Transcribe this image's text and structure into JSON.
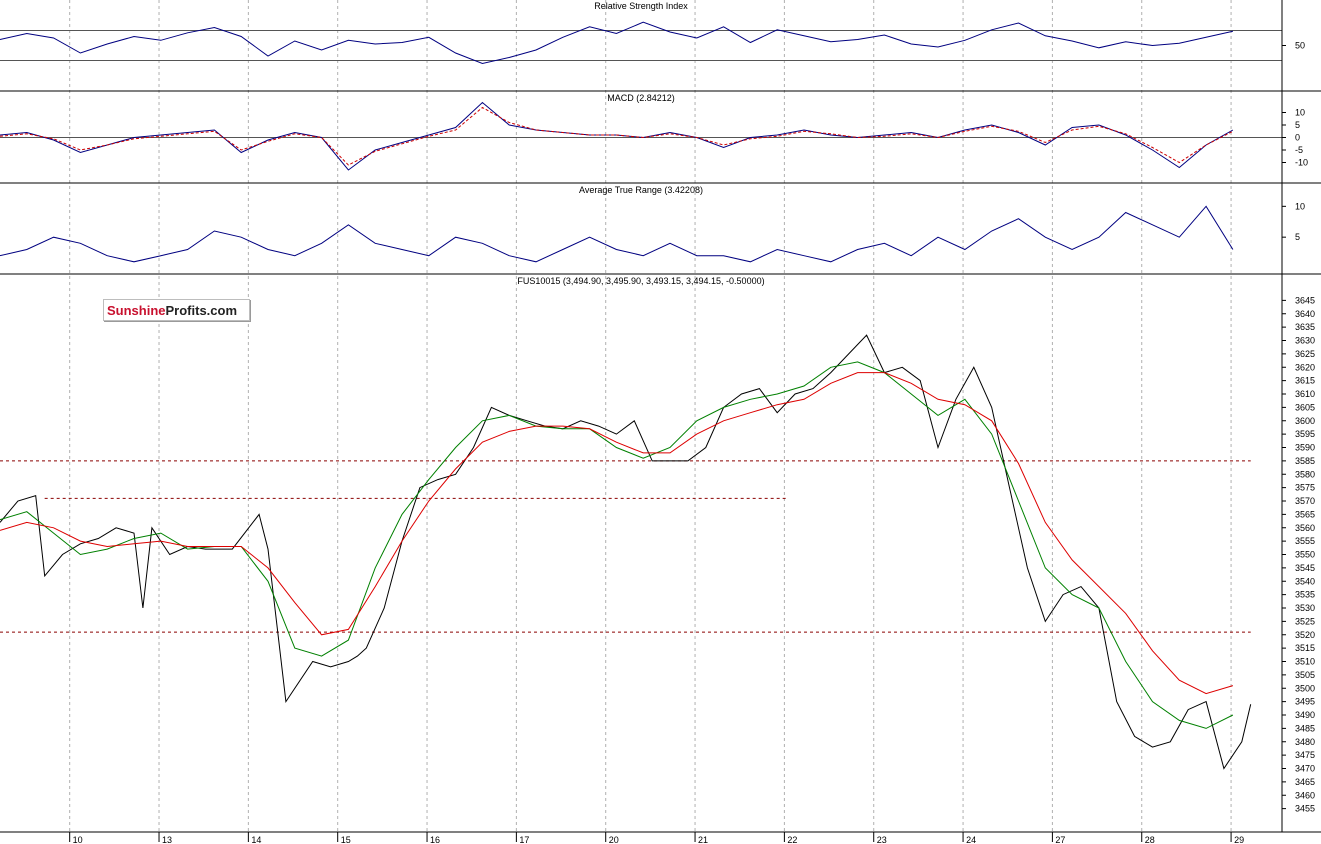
{
  "chart_data": {
    "type": "line",
    "symbol_label": "FUS10015 (3,494.90, 3,495.90, 3,493.15, 3,494.15, -0.50000)",
    "x_ticks": [
      "10",
      "13",
      "14",
      "15",
      "16",
      "17",
      "20",
      "21",
      "22",
      "23",
      "24",
      "27",
      "28",
      "29"
    ],
    "panels": [
      {
        "id": "rsi",
        "title": "Relative Strength Index",
        "type": "line",
        "y_ticks": [
          50
        ],
        "ylim": [
          0,
          100
        ],
        "reference_lines": [
          30,
          70
        ],
        "series": [
          {
            "color": "#000080",
            "x": [
              0,
              0.3,
              0.6,
              0.9,
              1.2,
              1.5,
              1.8,
              2.1,
              2.4,
              2.7,
              3.0,
              3.3,
              3.6,
              3.9,
              4.2,
              4.5,
              4.8,
              5.1,
              5.4,
              5.7,
              6.0,
              6.3,
              6.6,
              6.9,
              7.2,
              7.5,
              7.8,
              8.1,
              8.4,
              8.7,
              9.0,
              9.3,
              9.6,
              9.9,
              10.2,
              10.5,
              10.8,
              11.1,
              11.4,
              11.7,
              12.0,
              12.3,
              12.6,
              12.9,
              13.2,
              13.5,
              13.8
            ],
            "values": [
              58,
              66,
              60,
              40,
              52,
              62,
              57,
              67,
              74,
              62,
              36,
              56,
              44,
              57,
              52,
              54,
              61,
              40,
              26,
              34,
              44,
              61,
              75,
              66,
              81,
              68,
              60,
              75,
              54,
              71,
              63,
              55,
              58,
              64,
              52,
              48,
              57,
              71,
              80,
              63,
              56,
              47,
              55,
              50,
              53,
              61,
              69
            ]
          }
        ]
      },
      {
        "id": "macd",
        "title": "MACD (2.84212)",
        "type": "line",
        "y_ticks": [
          10,
          5,
          0,
          -5,
          -10
        ],
        "ylim": [
          -15,
          15
        ],
        "series": [
          {
            "color": "#000080",
            "x": [
              0,
              0.3,
              0.6,
              0.9,
              1.2,
              1.5,
              1.8,
              2.1,
              2.4,
              2.7,
              3.0,
              3.3,
              3.6,
              3.9,
              4.2,
              4.5,
              4.8,
              5.1,
              5.4,
              5.7,
              6.0,
              6.3,
              6.6,
              6.9,
              7.2,
              7.5,
              7.8,
              8.1,
              8.4,
              8.7,
              9.0,
              9.3,
              9.6,
              9.9,
              10.2,
              10.5,
              10.8,
              11.1,
              11.4,
              11.7,
              12.0,
              12.3,
              12.6,
              12.9,
              13.2,
              13.5,
              13.8
            ],
            "values": [
              1,
              2,
              -1,
              -6,
              -3,
              0,
              1,
              2,
              3,
              -6,
              -1,
              2,
              0,
              -13,
              -5,
              -2,
              1,
              4,
              14,
              5,
              3,
              2,
              1,
              1,
              0,
              2,
              0,
              -4,
              0,
              1,
              3,
              1,
              0,
              1,
              2,
              0,
              3,
              5,
              2,
              -3,
              4,
              5,
              1,
              -5,
              -12,
              -3,
              3
            ]
          },
          {
            "color": "#cc0000",
            "dashed": true,
            "x": [
              0,
              0.3,
              0.6,
              0.9,
              1.2,
              1.5,
              1.8,
              2.1,
              2.4,
              2.7,
              3.0,
              3.3,
              3.6,
              3.9,
              4.2,
              4.5,
              4.8,
              5.1,
              5.4,
              5.7,
              6.0,
              6.3,
              6.6,
              6.9,
              7.2,
              7.5,
              7.8,
              8.1,
              8.4,
              8.7,
              9.0,
              9.3,
              9.6,
              9.9,
              10.2,
              10.5,
              10.8,
              11.1,
              11.4,
              11.7,
              12.0,
              12.3,
              12.6,
              12.9,
              13.2,
              13.5,
              13.8
            ],
            "values": [
              0.5,
              1.5,
              -0.5,
              -5,
              -3,
              -0.5,
              0.5,
              1.5,
              2.5,
              -5,
              -1.5,
              1.5,
              0,
              -11,
              -5.5,
              -2.5,
              0.5,
              3,
              12,
              6,
              3,
              2,
              1,
              1,
              0,
              1.5,
              0,
              -3,
              -0.5,
              0.5,
              2.5,
              1.5,
              0,
              0.5,
              1.5,
              0,
              2.5,
              4.5,
              2.5,
              -2,
              3,
              4.5,
              1.5,
              -4,
              -10,
              -3,
              2.5
            ]
          }
        ]
      },
      {
        "id": "atr",
        "title": "Average True Range (3.42208)",
        "type": "line",
        "y_ticks": [
          10,
          5
        ],
        "ylim": [
          0,
          12
        ],
        "series": [
          {
            "color": "#000080",
            "x": [
              0,
              0.3,
              0.6,
              0.9,
              1.2,
              1.5,
              1.8,
              2.1,
              2.4,
              2.7,
              3.0,
              3.3,
              3.6,
              3.9,
              4.2,
              4.5,
              4.8,
              5.1,
              5.4,
              5.7,
              6.0,
              6.3,
              6.6,
              6.9,
              7.2,
              7.5,
              7.8,
              8.1,
              8.4,
              8.7,
              9.0,
              9.3,
              9.6,
              9.9,
              10.2,
              10.5,
              10.8,
              11.1,
              11.4,
              11.7,
              12.0,
              12.3,
              12.6,
              12.9,
              13.2,
              13.5,
              13.8
            ],
            "values": [
              2,
              3,
              5,
              4,
              2,
              1,
              2,
              3,
              6,
              5,
              3,
              2,
              4,
              7,
              4,
              3,
              2,
              5,
              4,
              2,
              1,
              3,
              5,
              3,
              2,
              4,
              2,
              2,
              1,
              3,
              2,
              1,
              3,
              4,
              2,
              5,
              3,
              6,
              8,
              5,
              3,
              5,
              9,
              7,
              5,
              10,
              3
            ]
          }
        ]
      },
      {
        "id": "price",
        "title": "FUS10015 (3,494.90, 3,495.90, 3,493.15, 3,494.15, -0.50000)",
        "type": "line",
        "ylim": [
          3450,
          3650
        ],
        "y_ticks": [
          3645,
          3640,
          3635,
          3630,
          3625,
          3620,
          3615,
          3610,
          3605,
          3600,
          3595,
          3590,
          3585,
          3580,
          3575,
          3570,
          3565,
          3560,
          3555,
          3550,
          3545,
          3540,
          3535,
          3530,
          3525,
          3520,
          3515,
          3510,
          3505,
          3500,
          3495,
          3490,
          3485,
          3480,
          3475,
          3470,
          3465,
          3460,
          3455
        ],
        "reference_lines": [
          {
            "y": 3585,
            "x_start": 0,
            "x_end": 14
          },
          {
            "y": 3571,
            "x_start": 0.5,
            "x_end": 8.8
          },
          {
            "y": 3521,
            "x_start": 0,
            "x_end": 14
          }
        ],
        "series": [
          {
            "color": "#000000",
            "x": [
              0,
              0.2,
              0.4,
              0.5,
              0.7,
              0.9,
              1.1,
              1.3,
              1.5,
              1.6,
              1.7,
              1.9,
              2.1,
              2.3,
              2.6,
              2.9,
              3.0,
              3.2,
              3.5,
              3.7,
              3.9,
              4.0,
              4.1,
              4.3,
              4.5,
              4.7,
              4.9,
              5.1,
              5.3,
              5.5,
              5.7,
              5.9,
              6.1,
              6.3,
              6.5,
              6.7,
              6.9,
              7.1,
              7.3,
              7.5,
              7.7,
              7.9,
              8.1,
              8.3,
              8.5,
              8.7,
              8.9,
              9.1,
              9.3,
              9.5,
              9.7,
              9.9,
              10.1,
              10.3,
              10.5,
              10.7,
              10.9,
              11.1,
              11.3,
              11.5,
              11.7,
              11.9,
              12.1,
              12.3,
              12.5,
              12.7,
              12.9,
              13.1,
              13.3,
              13.5,
              13.7,
              13.9,
              14.0
            ],
            "values": [
              3562,
              3570,
              3572,
              3542,
              3550,
              3554,
              3556,
              3560,
              3558,
              3530,
              3560,
              3550,
              3553,
              3552,
              3552,
              3565,
              3552,
              3495,
              3510,
              3508,
              3510,
              3512,
              3515,
              3530,
              3555,
              3575,
              3578,
              3580,
              3590,
              3605,
              3602,
              3600,
              3598,
              3597,
              3600,
              3598,
              3595,
              3600,
              3585,
              3585,
              3585,
              3590,
              3605,
              3610,
              3612,
              3603,
              3610,
              3612,
              3618,
              3625,
              3632,
              3618,
              3620,
              3615,
              3590,
              3608,
              3620,
              3605,
              3575,
              3545,
              3525,
              3535,
              3538,
              3530,
              3495,
              3482,
              3478,
              3480,
              3492,
              3495,
              3470,
              3480,
              3494
            ]
          },
          {
            "color": "#008000",
            "x": [
              0,
              0.3,
              0.6,
              0.9,
              1.2,
              1.5,
              1.8,
              2.1,
              2.4,
              2.7,
              3.0,
              3.3,
              3.6,
              3.9,
              4.2,
              4.5,
              4.8,
              5.1,
              5.4,
              5.7,
              6.0,
              6.3,
              6.6,
              6.9,
              7.2,
              7.5,
              7.8,
              8.1,
              8.4,
              8.7,
              9.0,
              9.3,
              9.6,
              9.9,
              10.2,
              10.5,
              10.8,
              11.1,
              11.4,
              11.7,
              12.0,
              12.3,
              12.6,
              12.9,
              13.2,
              13.5,
              13.8
            ],
            "values": [
              3563,
              3566,
              3558,
              3550,
              3552,
              3556,
              3558,
              3552,
              3553,
              3553,
              3540,
              3515,
              3512,
              3518,
              3545,
              3565,
              3578,
              3590,
              3600,
              3602,
              3598,
              3597,
              3597,
              3590,
              3586,
              3590,
              3600,
              3605,
              3608,
              3610,
              3613,
              3620,
              3622,
              3618,
              3610,
              3602,
              3608,
              3595,
              3570,
              3545,
              3535,
              3530,
              3510,
              3495,
              3488,
              3485,
              3490
            ]
          },
          {
            "color": "#dd0000",
            "x": [
              0,
              0.3,
              0.6,
              0.9,
              1.2,
              1.5,
              1.8,
              2.1,
              2.4,
              2.7,
              3.0,
              3.3,
              3.6,
              3.9,
              4.2,
              4.5,
              4.8,
              5.1,
              5.4,
              5.7,
              6.0,
              6.3,
              6.6,
              6.9,
              7.2,
              7.5,
              7.8,
              8.1,
              8.4,
              8.7,
              9.0,
              9.3,
              9.6,
              9.9,
              10.2,
              10.5,
              10.8,
              11.1,
              11.4,
              11.7,
              12.0,
              12.3,
              12.6,
              12.9,
              13.2,
              13.5,
              13.8
            ],
            "values": [
              3559,
              3562,
              3560,
              3555,
              3553,
              3554,
              3555,
              3553,
              3553,
              3553,
              3545,
              3532,
              3520,
              3522,
              3538,
              3555,
              3570,
              3582,
              3592,
              3596,
              3598,
              3598,
              3597,
              3592,
              3588,
              3588,
              3595,
              3600,
              3603,
              3606,
              3608,
              3614,
              3618,
              3618,
              3614,
              3608,
              3606,
              3600,
              3584,
              3562,
              3548,
              3538,
              3528,
              3514,
              3503,
              3498,
              3501
            ]
          }
        ]
      }
    ]
  },
  "logo": {
    "part1": "Sunshine",
    "part2": "Profits.com"
  }
}
